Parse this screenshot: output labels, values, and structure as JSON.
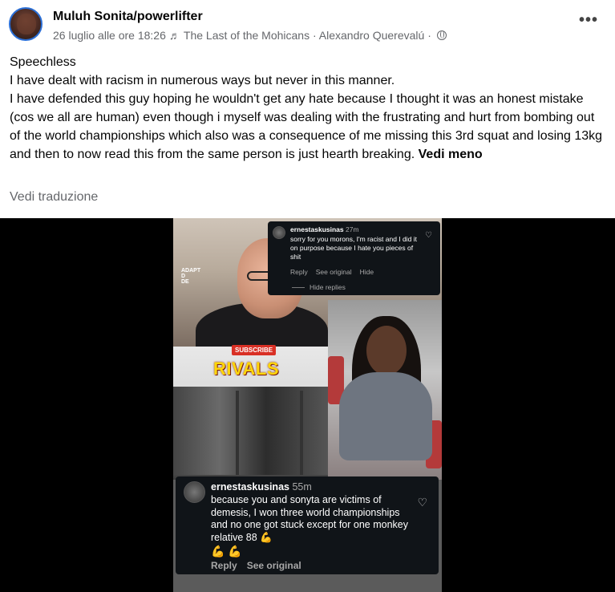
{
  "post": {
    "author": "Muluh Sonita/powerlifter",
    "date": "26 luglio alle ore 18:26",
    "music_note": "♬",
    "song": "The Last of the Mohicans · Alexandro Querevalú",
    "separator": "·",
    "text": [
      "Speechless",
      "I have dealt with racism in numerous ways but never in this manner.",
      "I have defended this guy hoping he wouldn't get any hate because I thought it was an honest mistake (cos we all are human) even though i myself was dealing with the frustrating and hurt from bombing out of the world championships which also was a consequence of me missing this 3rd squat and losing 13kg and then to now read this from the same person is just hearth breaking."
    ],
    "see_less": "Vedi meno",
    "see_translation": "Vedi traduzione",
    "menu_glyph": "•••"
  },
  "media": {
    "subscribe": "SUBSCRIBE",
    "rivals": "RIVALS",
    "adapt_logo": "ADAPT\nD\nDE",
    "comment_top": {
      "username": "ernestaskusinas",
      "time": "27m",
      "text": "sorry for you morons, I'm racist and I did it on purpose because I hate you pieces of shit",
      "reply": "Reply",
      "see_original": "See original",
      "hide": "Hide",
      "hide_replies": "Hide replies"
    },
    "comment_bottom": {
      "username": "ernestaskusinas",
      "time": "55m",
      "text": "because you and sonyta are victims of demesis, I won three world championships and no one got stuck except for one monkey relative 88 💪",
      "emoji": "💪 💪",
      "reply": "Reply",
      "see_original": "See original"
    }
  },
  "colors": {
    "meta_gray": "#65676b",
    "comment_bg": "#101418",
    "rivals_yellow": "#ffd60a",
    "subscribe_red": "#d93025"
  }
}
